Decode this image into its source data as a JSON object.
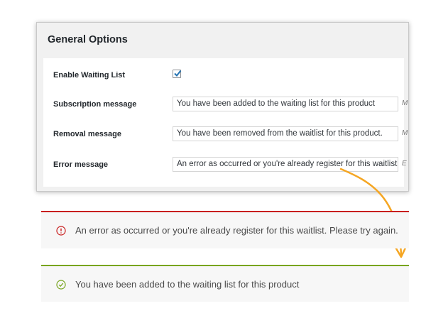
{
  "panel": {
    "title": "General Options",
    "rows": [
      {
        "label": "Enable Waiting List",
        "type": "checkbox",
        "checked": true
      },
      {
        "label": "Subscription message",
        "type": "text",
        "value": "You have been added to the waiting list for this product",
        "trailing": "M"
      },
      {
        "label": "Removal message",
        "type": "text",
        "value": "You have been removed from the waitlist for this product.",
        "trailing": "M"
      },
      {
        "label": "Error message",
        "type": "text",
        "value": "An error as occurred or you're already register for this waitlist. Pl",
        "trailing": "E"
      }
    ]
  },
  "notices": {
    "error": {
      "text": "An error as occurred or you're already register for this waitlist. Please try again.",
      "icon": "exclamation-circle-icon",
      "color": "#c81e1e"
    },
    "success": {
      "text": "You have been added to the waiting list for this product",
      "icon": "check-circle-icon",
      "color": "#78a51e"
    }
  },
  "colors": {
    "arrow": "#f5a623",
    "checkmark": "#2271b1"
  }
}
